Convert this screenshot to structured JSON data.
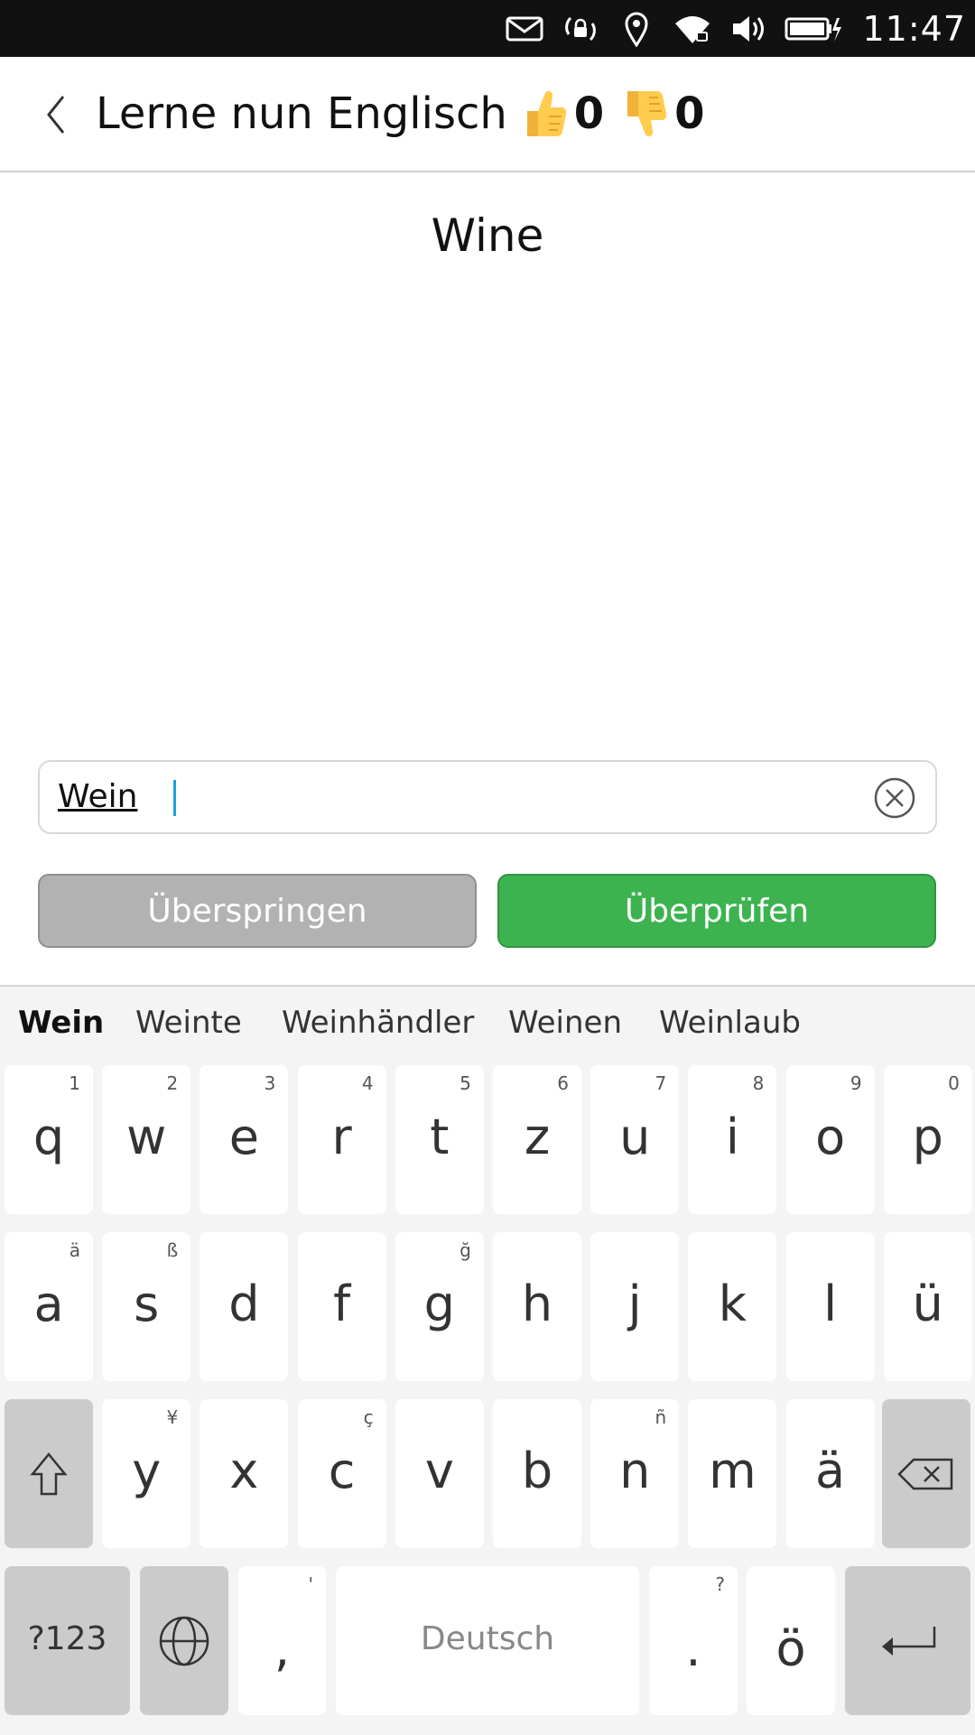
{
  "status": {
    "time": "11:47"
  },
  "header": {
    "title": "Lerne nun Englisch",
    "thumbs_up_count": "0",
    "thumbs_down_count": "0"
  },
  "prompt_word": "Wine",
  "answer": {
    "value": "Wein"
  },
  "buttons": {
    "skip": "Überspringen",
    "check": "Überprüfen"
  },
  "keyboard": {
    "suggestions": [
      "Wein",
      "Weinte",
      "Weinhändler",
      "Weinen",
      "Weinlaub"
    ],
    "row1": [
      {
        "ch": "q",
        "alt": "1"
      },
      {
        "ch": "w",
        "alt": "2"
      },
      {
        "ch": "e",
        "alt": "3"
      },
      {
        "ch": "r",
        "alt": "4"
      },
      {
        "ch": "t",
        "alt": "5"
      },
      {
        "ch": "z",
        "alt": "6"
      },
      {
        "ch": "u",
        "alt": "7"
      },
      {
        "ch": "i",
        "alt": "8"
      },
      {
        "ch": "o",
        "alt": "9"
      },
      {
        "ch": "p",
        "alt": "0"
      }
    ],
    "row2": [
      {
        "ch": "a",
        "alt": "ä"
      },
      {
        "ch": "s",
        "alt": "ß"
      },
      {
        "ch": "d",
        "alt": ""
      },
      {
        "ch": "f",
        "alt": ""
      },
      {
        "ch": "g",
        "alt": "ğ"
      },
      {
        "ch": "h",
        "alt": ""
      },
      {
        "ch": "j",
        "alt": ""
      },
      {
        "ch": "k",
        "alt": ""
      },
      {
        "ch": "l",
        "alt": ""
      },
      {
        "ch": "ü",
        "alt": ""
      }
    ],
    "row3": [
      {
        "ch": "y",
        "alt": "¥"
      },
      {
        "ch": "x",
        "alt": ""
      },
      {
        "ch": "c",
        "alt": "ç"
      },
      {
        "ch": "v",
        "alt": ""
      },
      {
        "ch": "b",
        "alt": ""
      },
      {
        "ch": "n",
        "alt": "ñ"
      },
      {
        "ch": "m",
        "alt": ""
      },
      {
        "ch": "ä",
        "alt": ""
      }
    ],
    "row4": {
      "symbols": "?123",
      "comma": ",",
      "comma_alt": "'",
      "space": "Deutsch",
      "period": ".",
      "period_alt": "?",
      "o_umlaut": "ö"
    }
  }
}
